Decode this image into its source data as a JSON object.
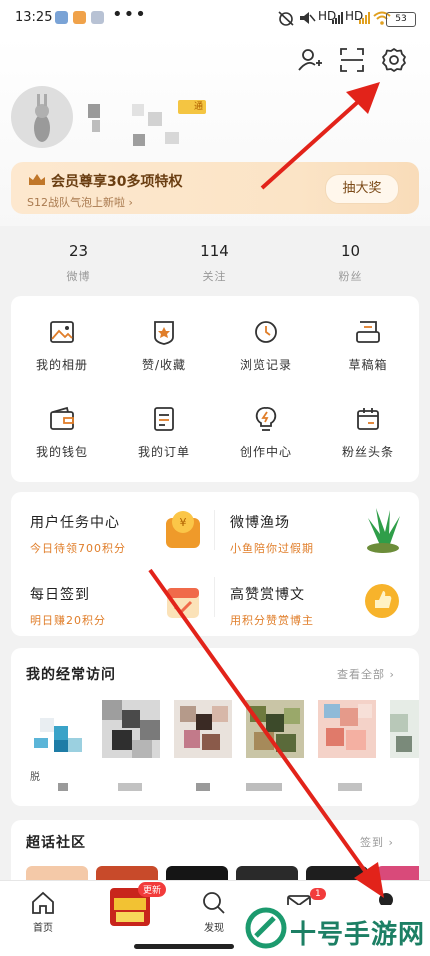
{
  "status_bar": {
    "time": "13:25",
    "more": "•••",
    "signal_1": "HD",
    "signal_2": "HD",
    "battery": "53"
  },
  "header": {
    "vip_badge": "通"
  },
  "vip_banner": {
    "title": "会员尊享30多项特权",
    "subtitle": "S12战队气泡上新啦 ›",
    "button": "抽大奖"
  },
  "stats": [
    {
      "value": "23",
      "label": "微博"
    },
    {
      "value": "114",
      "label": "关注"
    },
    {
      "value": "10",
      "label": "粉丝"
    }
  ],
  "tools": [
    {
      "label": "我的相册",
      "icon": "photo-album-icon"
    },
    {
      "label": "赞/收藏",
      "icon": "like-collect-icon"
    },
    {
      "label": "浏览记录",
      "icon": "history-icon"
    },
    {
      "label": "草稿箱",
      "icon": "drafts-icon"
    },
    {
      "label": "我的钱包",
      "icon": "wallet-icon"
    },
    {
      "label": "我的订单",
      "icon": "order-icon"
    },
    {
      "label": "创作中心",
      "icon": "creator-icon"
    },
    {
      "label": "粉丝头条",
      "icon": "fans-headline-icon"
    }
  ],
  "tasks": [
    {
      "title": "用户任务中心",
      "sub": "今日待领700积分"
    },
    {
      "title": "微博渔场",
      "sub": "小鱼陪你过假期"
    },
    {
      "title": "每日签到",
      "sub": "明日赚20积分"
    },
    {
      "title": "高赞赏博文",
      "sub": "用积分赞赏博主"
    }
  ],
  "frequent_visits": {
    "title": "我的经常访问",
    "more": "查看全部 ›",
    "first_name": "脱"
  },
  "super_topic": {
    "title": "超话社区",
    "more": "签到 ›"
  },
  "tabbar": {
    "tabs": [
      {
        "label": "首页",
        "icon": "home-icon"
      },
      {
        "label": "",
        "icon": "promo-icon",
        "badge": "更新"
      },
      {
        "label": "发现",
        "icon": "search-icon"
      },
      {
        "label": "",
        "icon": "message-icon",
        "badge": "1"
      },
      {
        "label": "",
        "icon": "profile-icon"
      }
    ]
  },
  "watermark": {
    "text": "十号手游网"
  },
  "colors": {
    "accent_orange": "#e07e2a",
    "vip_text": "#6a3e12",
    "arrow_red": "#e2231a",
    "watermark_green": "#1c7f64"
  }
}
